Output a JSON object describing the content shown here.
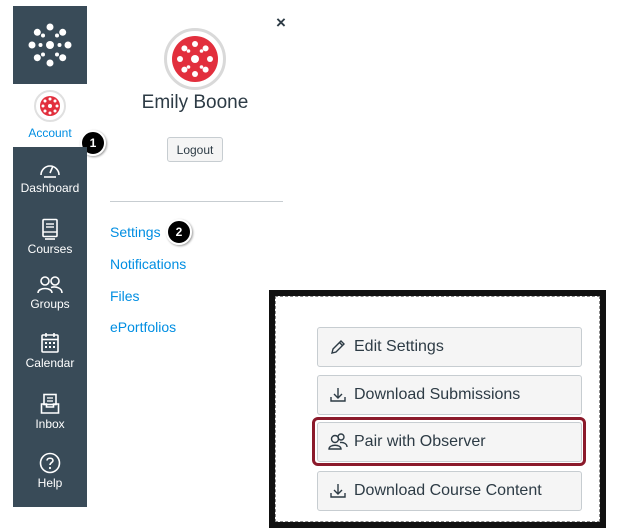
{
  "nav": {
    "account_label": "Account",
    "items": [
      {
        "label": "Dashboard",
        "icon": "dashboard-icon"
      },
      {
        "label": "Courses",
        "icon": "courses-icon"
      },
      {
        "label": "Groups",
        "icon": "groups-icon"
      },
      {
        "label": "Calendar",
        "icon": "calendar-icon"
      },
      {
        "label": "Inbox",
        "icon": "inbox-icon"
      },
      {
        "label": "Help",
        "icon": "help-icon"
      }
    ]
  },
  "badges": {
    "one": "1",
    "two": "2"
  },
  "tray": {
    "close": "×",
    "user_name": "Emily Boone",
    "logout_label": "Logout",
    "links": [
      "Settings",
      "Notifications",
      "Files",
      "ePortfolios"
    ]
  },
  "sidebar_buttons": [
    {
      "label": "Edit Settings",
      "icon": "pencil-icon"
    },
    {
      "label": "Download Submissions",
      "icon": "download-icon"
    },
    {
      "label": "Pair with Observer",
      "icon": "user-pair-icon"
    },
    {
      "label": "Download Course Content",
      "icon": "download-icon"
    }
  ],
  "colors": {
    "nav_bg": "#394b58",
    "link": "#008ee2",
    "brand_red": "#e22f3d",
    "highlight": "#8b1a2b"
  }
}
